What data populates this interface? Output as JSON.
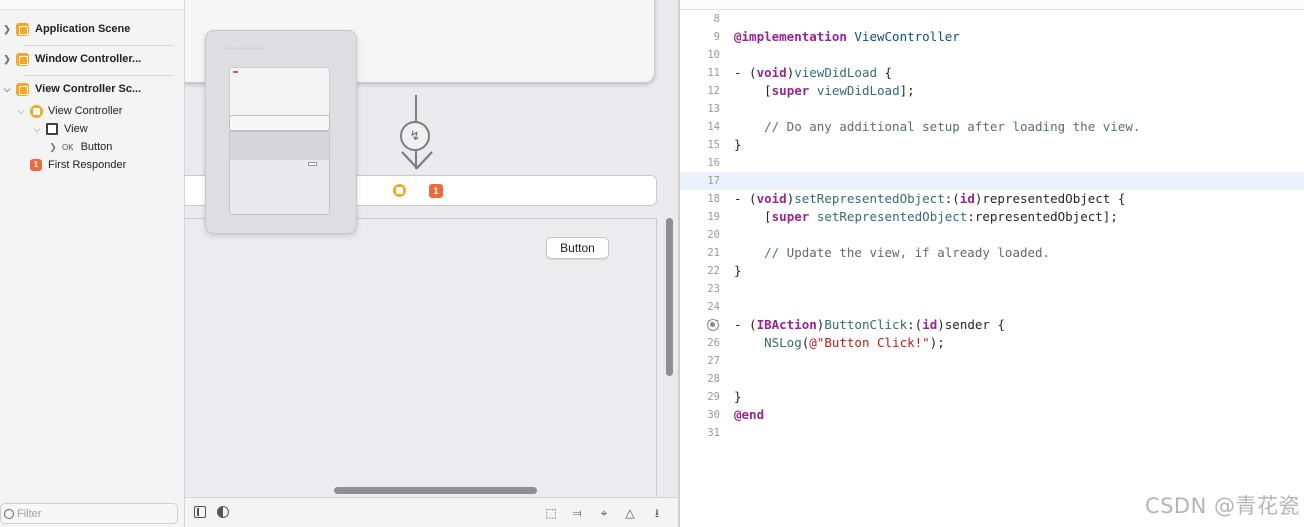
{
  "outline": {
    "items": [
      {
        "label": "Application Scene"
      },
      {
        "label": "Window Controller..."
      },
      {
        "label": "View Controller Sc..."
      },
      {
        "label": "View Controller"
      },
      {
        "label": "View"
      },
      {
        "label": "Button"
      },
      {
        "label": "First Responder"
      }
    ],
    "filter_placeholder": "Filter"
  },
  "canvas": {
    "button_label": "Button",
    "first_responder_badge": "1",
    "segue_glyph": "↯"
  },
  "editor": {
    "current_line": 17,
    "breakpoint_line": 25,
    "lines": [
      {
        "num": "8",
        "text": ""
      },
      {
        "num": "9",
        "text": "@implementation ViewController"
      },
      {
        "num": "10",
        "text": ""
      },
      {
        "num": "11",
        "text": "- (void)viewDidLoad {"
      },
      {
        "num": "12",
        "text": "    [super viewDidLoad];"
      },
      {
        "num": "13",
        "text": ""
      },
      {
        "num": "14",
        "text": "    // Do any additional setup after loading the view."
      },
      {
        "num": "15",
        "text": "}"
      },
      {
        "num": "16",
        "text": ""
      },
      {
        "num": "17",
        "text": ""
      },
      {
        "num": "18",
        "text": "- (void)setRepresentedObject:(id)representedObject {"
      },
      {
        "num": "19",
        "text": "    [super setRepresentedObject:representedObject];"
      },
      {
        "num": "20",
        "text": ""
      },
      {
        "num": "21",
        "text": "    // Update the view, if already loaded."
      },
      {
        "num": "22",
        "text": "}"
      },
      {
        "num": "23",
        "text": ""
      },
      {
        "num": "24",
        "text": ""
      },
      {
        "num": "25",
        "text": "- (IBAction)ButtonClick:(id)sender {"
      },
      {
        "num": "26",
        "text": "    NSLog(@\"Button Click!\");"
      },
      {
        "num": "27",
        "text": ""
      },
      {
        "num": "28",
        "text": ""
      },
      {
        "num": "29",
        "text": "}"
      },
      {
        "num": "30",
        "text": "@end"
      },
      {
        "num": "31",
        "text": ""
      }
    ]
  },
  "watermark": "CSDN @青花瓷",
  "colors": {
    "scene_icon": "#f5a623",
    "first_responder": "#ec6a3c",
    "keyword": "#9b2393",
    "comment": "#5d6c79",
    "string": "#c41a16",
    "current_line": "#e9f2fb"
  },
  "icons": [
    "scene-icon",
    "view-controller-icon",
    "view-icon",
    "button-icon",
    "first-responder-icon",
    "segue-icon",
    "filter-icon",
    "breakpoint-icon"
  ]
}
